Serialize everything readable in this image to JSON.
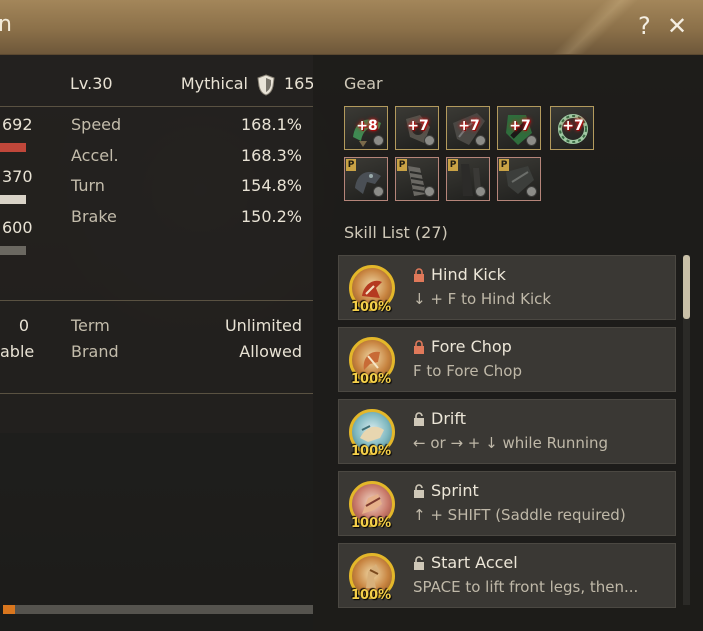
{
  "window": {
    "title_fragment": "n",
    "help_icon": "question-mark-icon",
    "close_icon": "close-icon"
  },
  "stats": {
    "level": "Lv.30",
    "grade": "Mythical",
    "grade_icon": "shield-icon",
    "grade_value": "165",
    "partial_values": [
      "692",
      "370",
      "600"
    ],
    "partial_bar_colors": [
      "#c0473a",
      "#d9d3c7",
      "#6b6861"
    ],
    "rows": [
      {
        "label": "Speed",
        "value": "168.1%"
      },
      {
        "label": "Accel.",
        "value": "168.3%"
      },
      {
        "label": "Turn",
        "value": "154.8%"
      },
      {
        "label": "Brake",
        "value": "150.2%"
      }
    ],
    "extra_left": [
      "0",
      "able"
    ],
    "info": [
      {
        "label": "Term",
        "value": "Unlimited"
      },
      {
        "label": "Brand",
        "value": "Allowed"
      }
    ]
  },
  "gear": {
    "title": "Gear",
    "slots_row1": [
      {
        "icon": "saddle-icon",
        "enhance": "+8"
      },
      {
        "icon": "stirrups-icon",
        "enhance": "+7"
      },
      {
        "icon": "barding-icon",
        "enhance": "+7"
      },
      {
        "icon": "horseshoe-icon",
        "enhance": "+7"
      },
      {
        "icon": "horseshoe-ring-icon",
        "enhance": "+7"
      }
    ],
    "slots_row2": [
      {
        "icon": "horse-head-gear-icon",
        "badge": "P"
      },
      {
        "icon": "horse-armor-icon",
        "badge": "P"
      },
      {
        "icon": "horse-legs-icon",
        "badge": "P"
      },
      {
        "icon": "horse-tail-icon",
        "badge": "P"
      }
    ]
  },
  "skills": {
    "title": "Skill List (27)",
    "items": [
      {
        "name": "Hind Kick",
        "desc": "↓ + F to Hind Kick",
        "percent": "100%",
        "icon": "hind-kick-skill-icon",
        "lock": "locked"
      },
      {
        "name": "Fore Chop",
        "desc": "F to Fore Chop",
        "percent": "100%",
        "icon": "fore-chop-skill-icon",
        "lock": "locked"
      },
      {
        "name": "Drift",
        "desc": "← or → + ↓ while Running",
        "percent": "100%",
        "icon": "drift-skill-icon",
        "lock": "unlocked"
      },
      {
        "name": "Sprint",
        "desc": "↑ + SHIFT (Saddle required)",
        "percent": "100%",
        "icon": "sprint-skill-icon",
        "lock": "unlocked"
      },
      {
        "name": "Start Accel",
        "desc": "SPACE to lift front legs, then...",
        "percent": "100%",
        "icon": "start-accel-skill-icon",
        "lock": "unlocked"
      }
    ],
    "scroll_position": 0.0
  },
  "progress": {
    "fraction": 0.04
  },
  "colors": {
    "lock_locked": "#e0795a",
    "lock_unlocked": "#cfc8b8",
    "percent": "#f5d04a"
  }
}
